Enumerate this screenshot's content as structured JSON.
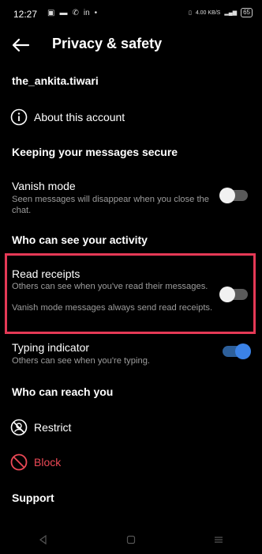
{
  "status": {
    "time": "12:27",
    "battery": "65",
    "speed": "4.00 KB/S"
  },
  "header": {
    "title": "Privacy & safety"
  },
  "account": {
    "username": "the_ankita.tiwari",
    "about_label": "About this account"
  },
  "sections": {
    "secure": "Keeping your messages secure",
    "activity": "Who can see your activity",
    "reach": "Who can reach you",
    "support": "Support"
  },
  "vanish": {
    "title": "Vanish mode",
    "desc": "Seen messages will disappear when you close the chat.",
    "enabled": false
  },
  "read_receipts": {
    "title": "Read receipts",
    "desc": "Others can see when you've read their messages.",
    "note": "Vanish mode messages always send read receipts.",
    "enabled": false
  },
  "typing": {
    "title": "Typing indicator",
    "desc": "Others can see when you're typing.",
    "enabled": true
  },
  "reach": {
    "restrict_label": "Restrict",
    "block_label": "Block"
  },
  "colors": {
    "highlight": "#e53956",
    "block": "#ed4956",
    "toggle_on": "#3b82e6"
  }
}
